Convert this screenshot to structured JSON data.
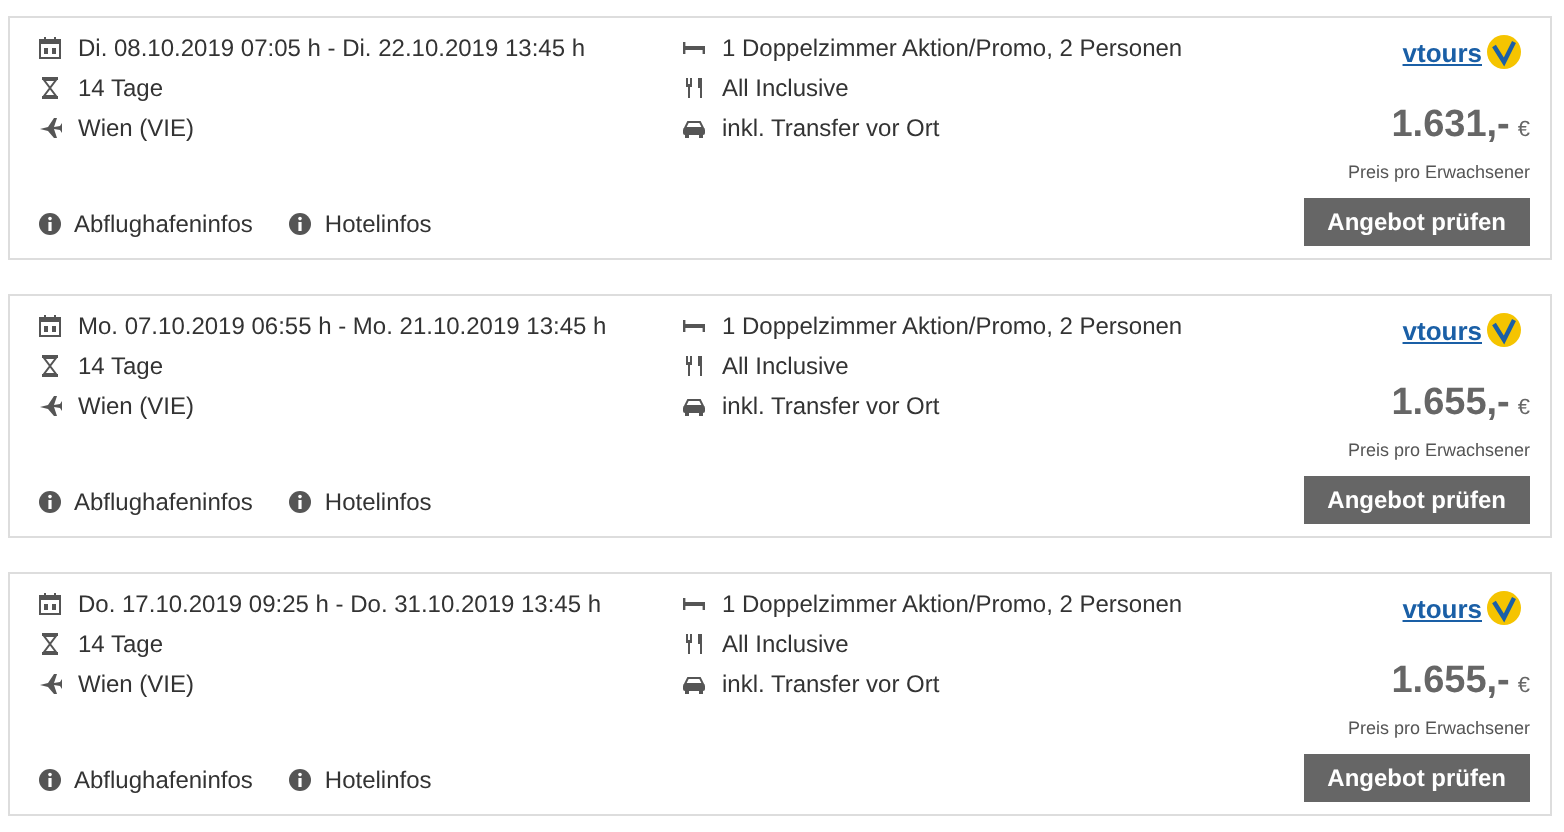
{
  "offers": [
    {
      "dates": "Di. 08.10.2019 07:05 h - Di. 22.10.2019 13:45 h",
      "duration": "14 Tage",
      "airport": "Wien (VIE)",
      "room": "1 Doppelzimmer Aktion/Promo, 2 Personen",
      "board": "All Inclusive",
      "transfer": "inkl. Transfer vor Ort",
      "links": [
        "Abflughafeninfos",
        "Hotelinfos"
      ],
      "logo": "vtours",
      "price": "1.631,-",
      "currency": "€",
      "price_note": "Preis pro Erwachsener",
      "button": "Angebot prüfen"
    },
    {
      "dates": "Mo. 07.10.2019 06:55 h - Mo. 21.10.2019 13:45 h",
      "duration": "14 Tage",
      "airport": "Wien (VIE)",
      "room": "1 Doppelzimmer Aktion/Promo, 2 Personen",
      "board": "All Inclusive",
      "transfer": "inkl. Transfer vor Ort",
      "links": [
        "Abflughafeninfos",
        "Hotelinfos"
      ],
      "logo": "vtours",
      "price": "1.655,-",
      "currency": "€",
      "price_note": "Preis pro Erwachsener",
      "button": "Angebot prüfen"
    },
    {
      "dates": "Do. 17.10.2019 09:25 h - Do. 31.10.2019 13:45 h",
      "duration": "14 Tage",
      "airport": "Wien (VIE)",
      "room": "1 Doppelzimmer Aktion/Promo, 2 Personen",
      "board": "All Inclusive",
      "transfer": "inkl. Transfer vor Ort",
      "links": [
        "Abflughafeninfos",
        "Hotelinfos"
      ],
      "logo": "vtours",
      "price": "1.655,-",
      "currency": "€",
      "price_note": "Preis pro Erwachsener",
      "button": "Angebot prüfen"
    }
  ]
}
